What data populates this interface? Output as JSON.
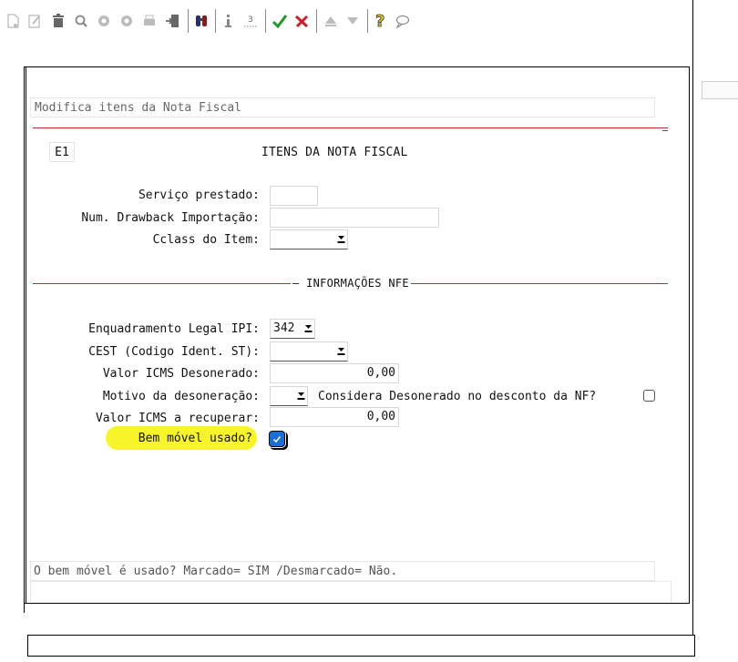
{
  "toolbar": {
    "icons": [
      "new-icon",
      "edit-icon",
      "delete-icon",
      "search-icon",
      "previous-icon",
      "next-icon",
      "print-icon",
      "exit-icon",
      "find-icon",
      "info-icon",
      "sum-icon",
      "confirm-icon",
      "cancel-icon",
      "up-icon",
      "down-icon",
      "help-icon",
      "comment-icon"
    ]
  },
  "form": {
    "title": "Modifica itens da Nota Fiscal",
    "code": "E1",
    "header": "ITENS DA NOTA FISCAL",
    "fields": {
      "servico_label": "Serviço prestado:",
      "servico_value": "",
      "drawback_label": "Num. Drawback Importação:",
      "drawback_value": "",
      "cclass_label": "Cclass do Item:",
      "cclass_value": ""
    },
    "nfe_section": "INFORMAÇÕES NFE",
    "nfe": {
      "enquadramento_label": "Enquadramento Legal IPI:",
      "enquadramento_value": "342",
      "cest_label": "CEST (Codigo Ident. ST):",
      "cest_value": "",
      "icms_desonerado_label": "Valor ICMS Desonerado:",
      "icms_desonerado_value": "0,00",
      "motivo_label": "Motivo da desoneração:",
      "motivo_value": "",
      "considera_label": "Considera Desonerado no desconto da NF?",
      "considera_checked": false,
      "icms_recuperar_label": "Valor ICMS a recuperar:",
      "icms_recuperar_value": "0,00",
      "bem_movel_label": "Bem móvel usado?",
      "bem_movel_checked": true
    },
    "help_text": "O bem móvel é usado? Marcado= SIM /Desmarcado= Não."
  },
  "colors": {
    "accent_line": "#c0282c",
    "highlight": "#f8f42a",
    "checkbox": "#1a6fd6"
  }
}
